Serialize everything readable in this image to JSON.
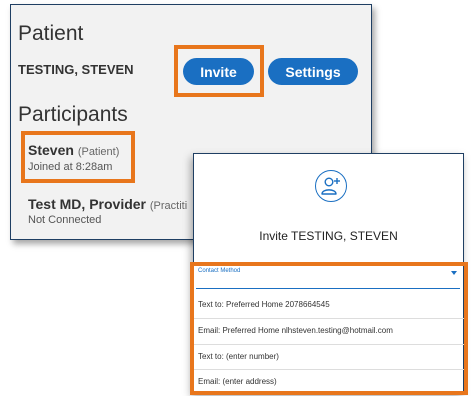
{
  "patient_section": {
    "heading": "Patient",
    "patient_name": "TESTING, STEVEN",
    "invite_button_label": "Invite",
    "settings_button_label": "Settings"
  },
  "participants_section": {
    "heading": "Participants",
    "participants": [
      {
        "name": "Steven",
        "role": "(Patient)",
        "status": "Joined at 8:28am"
      },
      {
        "name": "Test MD, Provider",
        "role": "(Practiti",
        "status": "Not Connected"
      }
    ]
  },
  "invite_dialog": {
    "icon": "add-person-icon",
    "title": "Invite TESTING, STEVEN",
    "contact_method_label": "Contact Method",
    "options": [
      "Text to: Preferred Home 2078664545",
      "Email: Preferred Home nlhsteven.testing@hotmail.com",
      "Text to: (enter number)",
      "Email: (enter address)"
    ]
  },
  "colors": {
    "accent_blue": "#1a6fc2",
    "highlight_orange": "#e8761c",
    "panel_border": "#1f3f63",
    "panel_background": "#f2f2f2"
  }
}
